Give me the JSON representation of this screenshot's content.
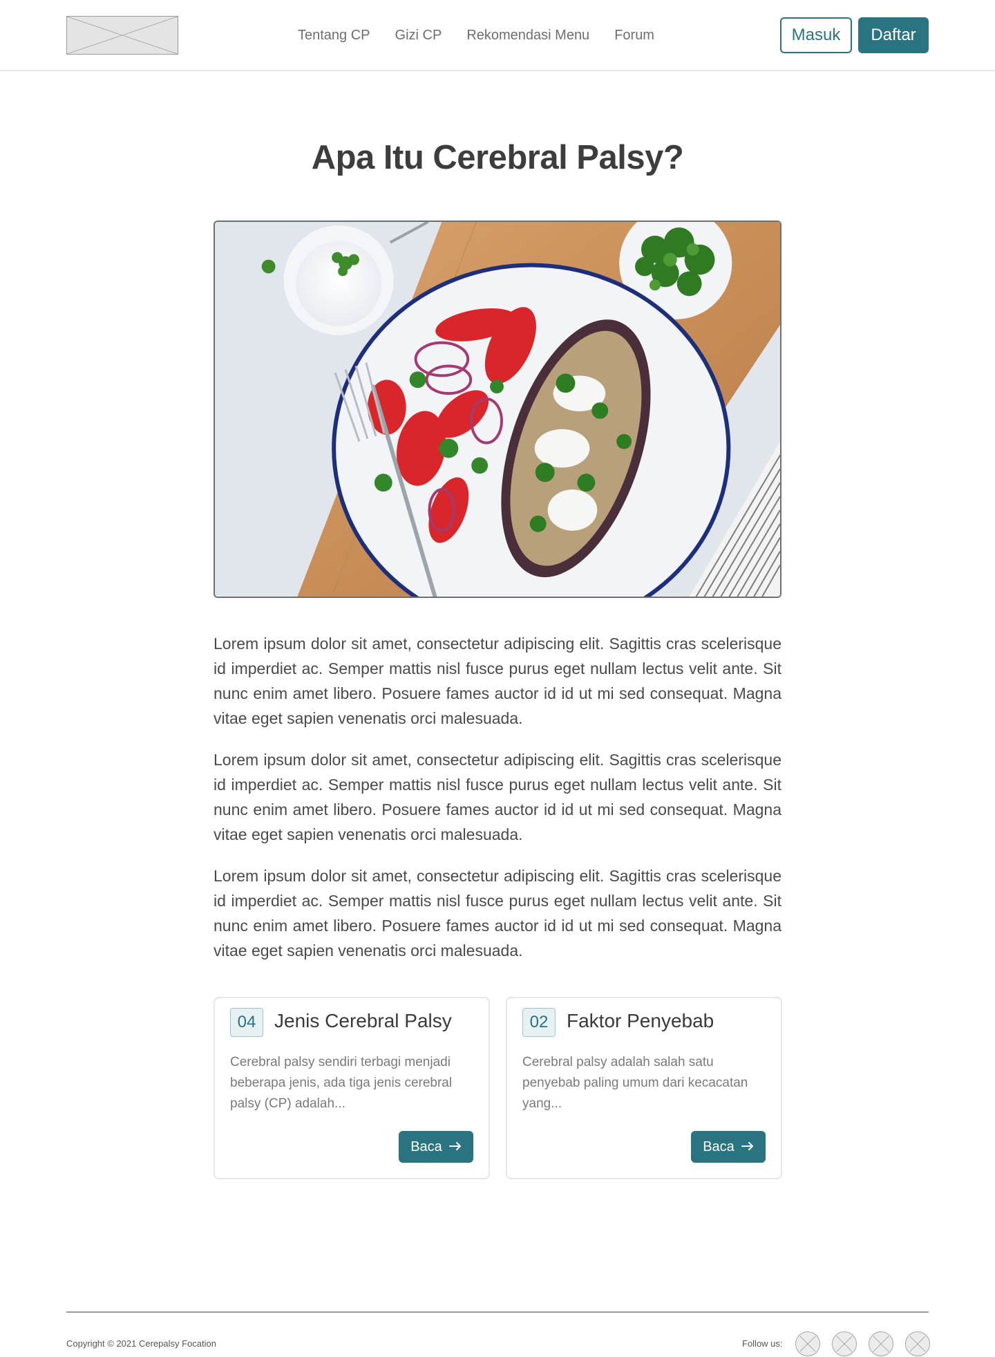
{
  "header": {
    "nav": [
      "Tentang CP",
      "Gizi CP",
      "Rekomendasi Menu",
      "Forum"
    ],
    "login_label": "Masuk",
    "register_label": "Daftar"
  },
  "main": {
    "title": "Apa Itu Cerebral Palsy?",
    "paragraphs": [
      "Lorem ipsum dolor sit amet, consectetur adipiscing elit. Sagittis cras scelerisque id imperdiet ac. Semper mattis nisl fusce purus eget nullam lectus velit ante. Sit nunc enim amet libero. Posuere fames auctor id id ut mi sed consequat. Magna vitae eget sapien venenatis orci malesuada.",
      "Lorem ipsum dolor sit amet, consectetur adipiscing elit. Sagittis cras scelerisque id imperdiet ac. Semper mattis nisl fusce purus eget nullam lectus velit ante. Sit nunc enim amet libero. Posuere fames auctor id id ut mi sed consequat. Magna vitae eget sapien venenatis orci malesuada.",
      "Lorem ipsum dolor sit amet, consectetur adipiscing elit. Sagittis cras scelerisque id imperdiet ac. Semper mattis nisl fusce purus eget nullam lectus velit ante. Sit nunc enim amet libero. Posuere fames auctor id id ut mi sed consequat. Magna vitae eget sapien venenatis orci malesuada."
    ],
    "cards": [
      {
        "number": "04",
        "title": "Jenis Cerebral Palsy",
        "description": "Cerebral palsy sendiri terbagi menjadi beberapa jenis, ada tiga jenis cerebral palsy (CP) adalah...",
        "button_label": "Baca",
        "button_icon": "arrow-right-icon"
      },
      {
        "number": "02",
        "title": "Faktor Penyebab",
        "description": "Cerebral palsy adalah salah satu penyebab paling umum dari kecacatan yang...",
        "button_label": "Baca",
        "button_icon": "arrow-right-icon"
      }
    ]
  },
  "footer": {
    "copyright": "Copyright © 2021 Cerepalsy Focation",
    "follow_label": "Follow us:"
  },
  "colors": {
    "accent": "#2a7381",
    "text_dark": "#3d3d3d",
    "text_muted": "#7a7a7a",
    "border": "#e6e6e6"
  }
}
